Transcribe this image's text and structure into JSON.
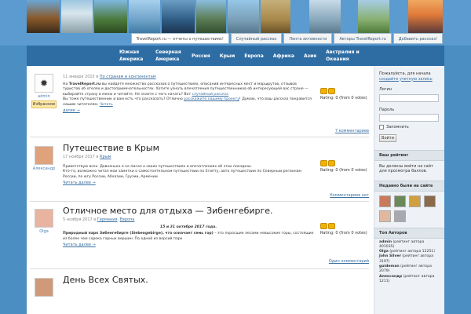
{
  "topnav": {
    "items": [
      "TravelReport.ru — отчеты о путешествиях!",
      "Случайный рассказ",
      "Лента активности",
      "Авторы TravelReport.ru",
      "Добавить рассказ!"
    ]
  },
  "mainnav": {
    "items": [
      "Южная Америка",
      "Северная Америка",
      "Россия",
      "Крым",
      "Европа",
      "Африка",
      "Азия",
      "Австралия и Океания"
    ]
  },
  "posts": [
    {
      "avatar_name": "admin",
      "badge": "Избранное",
      "date": "11 января 2015 в",
      "category": "По странам и континентам",
      "text1_a": "На ",
      "text1_b": "TravelReport.ru",
      "text1_c": " вы найдете множество рассказов о путешествиях, описаний интересных мест и маршрутов, отзывов туристов об отелях и достопримечательностях. Хотите узнать впечатления путешественников об интересующей вас стране — выбирайте страну в меню и читайте. Не знаете с чего начать? Вот ",
      "text1_link": "случайный рассказ",
      "text2_a": "Вы тоже путешественник и вам есть что рассказать? Отлично ",
      "text2_link": "расскажите нашему проекту",
      "text2_b": "! Думаю, что ваш рассказ понравится нашим читателям. ",
      "text2_more": "Читать",
      "more": "далее →",
      "rating": "Rating: 0 (from 0 votes)",
      "comments": "7 комментариев"
    },
    {
      "title": "Путешествие в Крым",
      "avatar_name": "Александр",
      "date": "17 ноября 2017 в",
      "category": "Крым",
      "text1": "Приветствую всех. Давненько я не писал о своих путешествиях и впечатлениях об этих поездках.",
      "text2": "Кто-то, возможно читал мои заметки о самостоятельном путешествии по Египту, авто путешествии по Северным регионам России, по югу России, Абхазии, Грузии, Армении.",
      "more": "Читать далее →",
      "rating": "Rating: 0 (from 0 votes)",
      "comments": "Комментариев нет"
    },
    {
      "title": "Отличное место для отдыха — Зибенгебирге.",
      "avatar_name": "Olga",
      "date": "5 ноября 2017 в",
      "category_a": "Германия",
      "category_b": "Европа",
      "center": "15 и 31 октября 2017 года.",
      "text_b1": "Природный парк Зибенгебирге (Siebengebirge), что означает семь гор)",
      "text_1": " – это поросшие лесами невысокие горы, состоящие из более чем сорока горных вершин. По одной из версий парк",
      "more": "Читать далее →",
      "rating": "Rating: 0 (from 0 votes)",
      "comments": "Один комментарий"
    },
    {
      "title": "День Всех Святых."
    }
  ],
  "sidebar": {
    "welcome": "Пожалуйста, для начала",
    "register": "создайте учетную запись",
    "login_label": "Логин",
    "password_label": "Пароль",
    "remember": "Запомнить",
    "login_button": "Войти",
    "rating_head": "Ваш рейтинг",
    "rating_text": "Вы должны войти на сайт для просмотра баллов.",
    "recent_head": "Недавно были на сайте",
    "top_head": "Топ Авторов",
    "authors": [
      {
        "name": "admin",
        "rest": " (рейтинг автора 401035)"
      },
      {
        "name": "Olga",
        "rest": " (рейтинг автора 12251)"
      },
      {
        "name": "John Silver",
        "rest": " (рейтинг автора 3197)"
      },
      {
        "name": "guideman",
        "rest": " (рейтинг автора 2079)"
      },
      {
        "name": "Александр",
        "rest": " (рейтинг автора 1211)"
      }
    ]
  }
}
